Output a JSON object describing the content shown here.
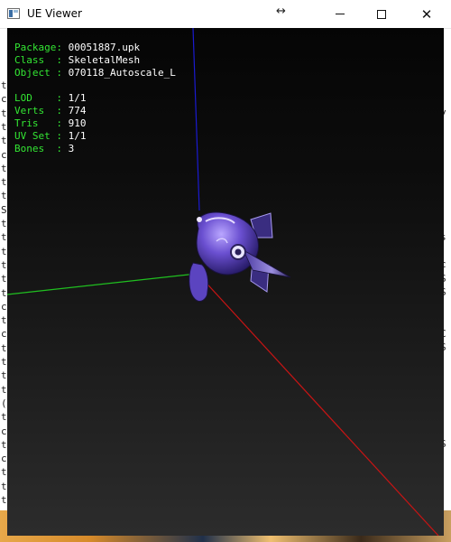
{
  "window": {
    "title": "UE Viewer",
    "resize_glyph": "↔",
    "close_glyph": "✕"
  },
  "info_block_1": [
    {
      "key": "Package",
      "value": "00051887.upk"
    },
    {
      "key": "Class  ",
      "value": "SkeletalMesh"
    },
    {
      "key": "Object ",
      "value": "070118_Autoscale_L"
    }
  ],
  "info_block_2": [
    {
      "key": "LOD    ",
      "value": "1/1"
    },
    {
      "key": "Verts  ",
      "value": "774"
    },
    {
      "key": "Tris   ",
      "value": "910"
    },
    {
      "key": "UV Set ",
      "value": "1/1"
    },
    {
      "key": "Bones  ",
      "value": "3"
    }
  ],
  "bg_console_left": [
    "t",
    "c",
    "t",
    "t",
    "t",
    "c",
    "t",
    "t",
    "t",
    "S",
    "t",
    "t",
    "t",
    "t",
    "t",
    "t",
    "c",
    "t",
    "c",
    "t",
    "t",
    "t",
    "t",
    "(",
    "t",
    "c",
    "t",
    "c",
    "t",
    "t",
    "t"
  ],
  "bg_console_right": [
    "y",
    "",
    "",
    "",
    "",
    "",
    "",
    "",
    "",
    "s",
    "",
    "c",
    "S",
    "S",
    "",
    "",
    "C",
    "S",
    "",
    "",
    "",
    "",
    "",
    "",
    "S",
    "",
    "",
    "",
    "",
    "",
    ""
  ],
  "colors": {
    "axis_x": "#c81414",
    "axis_y": "#20c020",
    "axis_z": "#1a1ad0",
    "info_key": "#33e633",
    "info_value": "#ffffff"
  }
}
